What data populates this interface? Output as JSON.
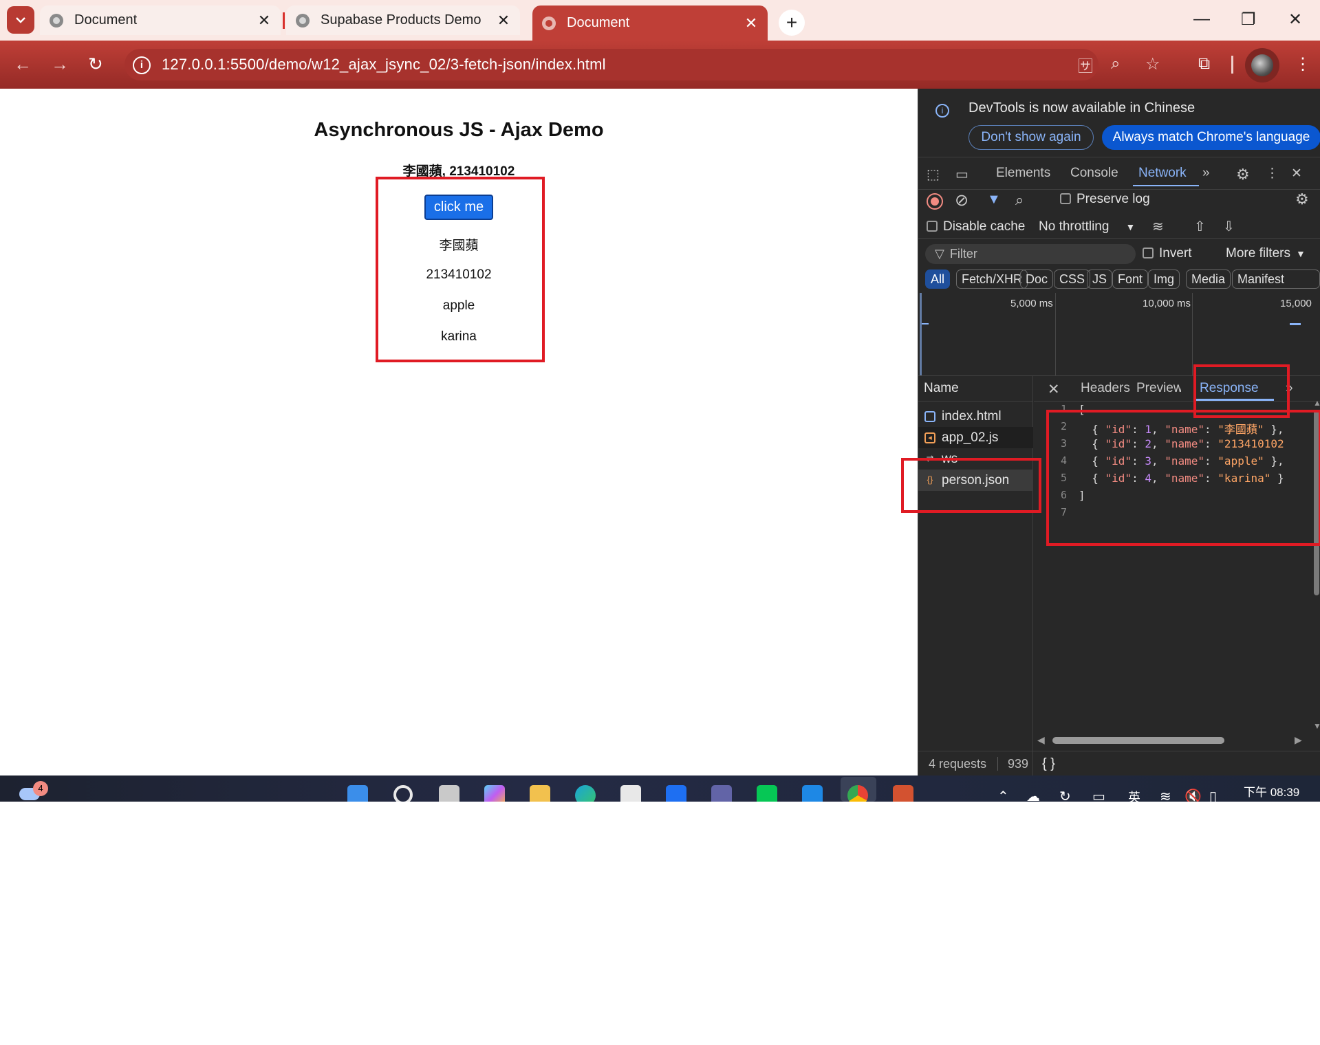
{
  "tabs": [
    {
      "title": "Document",
      "close": "✕"
    },
    {
      "title": "Supabase Products Demo",
      "close": "✕"
    },
    {
      "title": "Document",
      "close": "✕"
    }
  ],
  "new_tab": "+",
  "window": {
    "minimize": "—",
    "restore": "❐",
    "close": "✕"
  },
  "address": {
    "url": "127.0.0.1:5500/demo/w12_ajax_jsync_02/3-fetch-json/index.html"
  },
  "page": {
    "heading": "Asynchronous JS - Ajax Demo",
    "subheading": "李國蘋, 213410102",
    "button_label": "click me",
    "items": [
      "李國蘋",
      "213410102",
      "apple",
      "karina"
    ]
  },
  "devtools": {
    "notice": "DevTools is now available in Chinese",
    "dont_show": "Don't show again",
    "always_match": "Always match Chrome's language",
    "tabs": [
      "Elements",
      "Console",
      "Network"
    ],
    "preserve_log": "Preserve log",
    "disable_cache": "Disable cache",
    "throttling": "No throttling",
    "filter_placeholder": "Filter",
    "invert": "Invert",
    "more_filters": "More filters",
    "chips": [
      "All",
      "Fetch/XHR",
      "Doc",
      "CSS",
      "JS",
      "Font",
      "Img",
      "Media",
      "Manifest"
    ],
    "timeline_labels": [
      "5,000 ms",
      "10,000 ms",
      "15,000"
    ],
    "name_header": "Name",
    "requests": [
      "index.html",
      "app_02.js",
      "ws",
      "person.json"
    ],
    "response_tabs": [
      "Headers",
      "Preview",
      "Response"
    ],
    "code_lines": [
      "1",
      "2",
      "3",
      "4",
      "5",
      "6",
      "7"
    ],
    "json": [
      {
        "id": "1",
        "name": "\"李國蘋\""
      },
      {
        "id": "2",
        "name": "\"213410102"
      },
      {
        "id": "3",
        "name": "\"apple\""
      },
      {
        "id": "4",
        "name": "\"karina\""
      }
    ],
    "status_requests": "4 requests",
    "status_size": "939",
    "status_format": "{ }"
  },
  "taskbar": {
    "weather_badge": "4",
    "clock": "下午 08:39",
    "ime": "英"
  },
  "colors": {
    "accent": "#bf3f37",
    "highlight": "#e01b24",
    "devtools_link": "#8ab4f8"
  }
}
